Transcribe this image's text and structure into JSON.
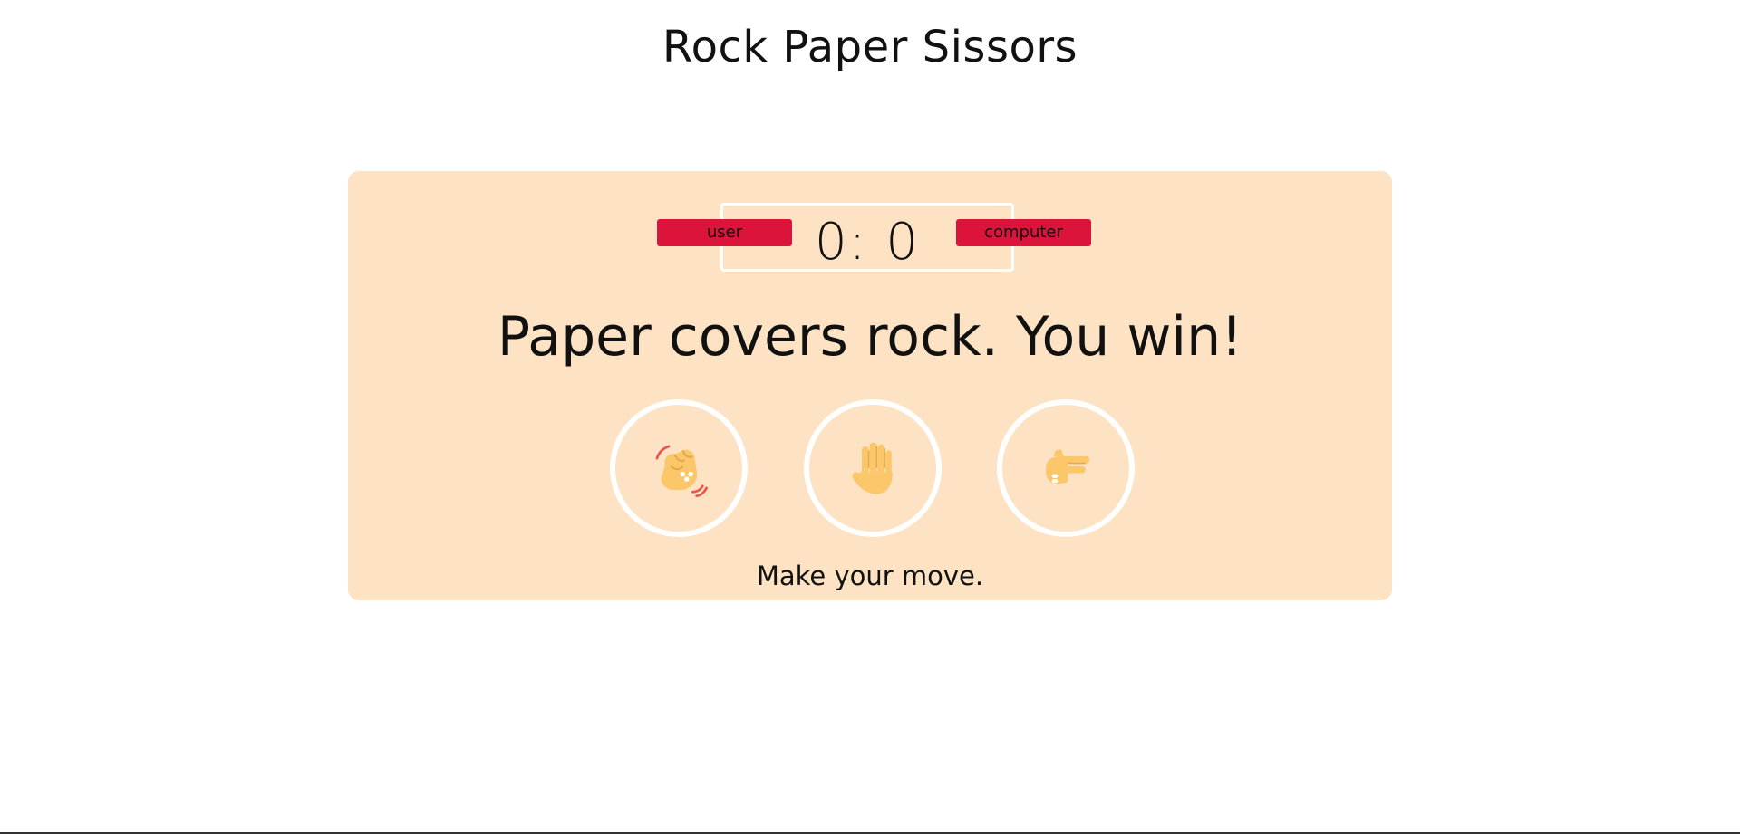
{
  "page": {
    "title": "Rock Paper Sissors"
  },
  "scoreboard": {
    "user_label": "user",
    "computer_label": "computer",
    "score_text": "0: 0"
  },
  "result": {
    "text": "Paper covers rock. You win!"
  },
  "choices": [
    {
      "id": "r",
      "icon": "rock-fist-icon"
    },
    {
      "id": "p",
      "icon": "paper-hand-icon"
    },
    {
      "id": "s",
      "icon": "scissors-hand-icon"
    }
  ],
  "message": {
    "text": "Make your move."
  },
  "colors": {
    "board_bg": "#fde3c3",
    "badge": "#dc143c",
    "circle_border": "#ffffff",
    "hand": "#fcc76b"
  }
}
